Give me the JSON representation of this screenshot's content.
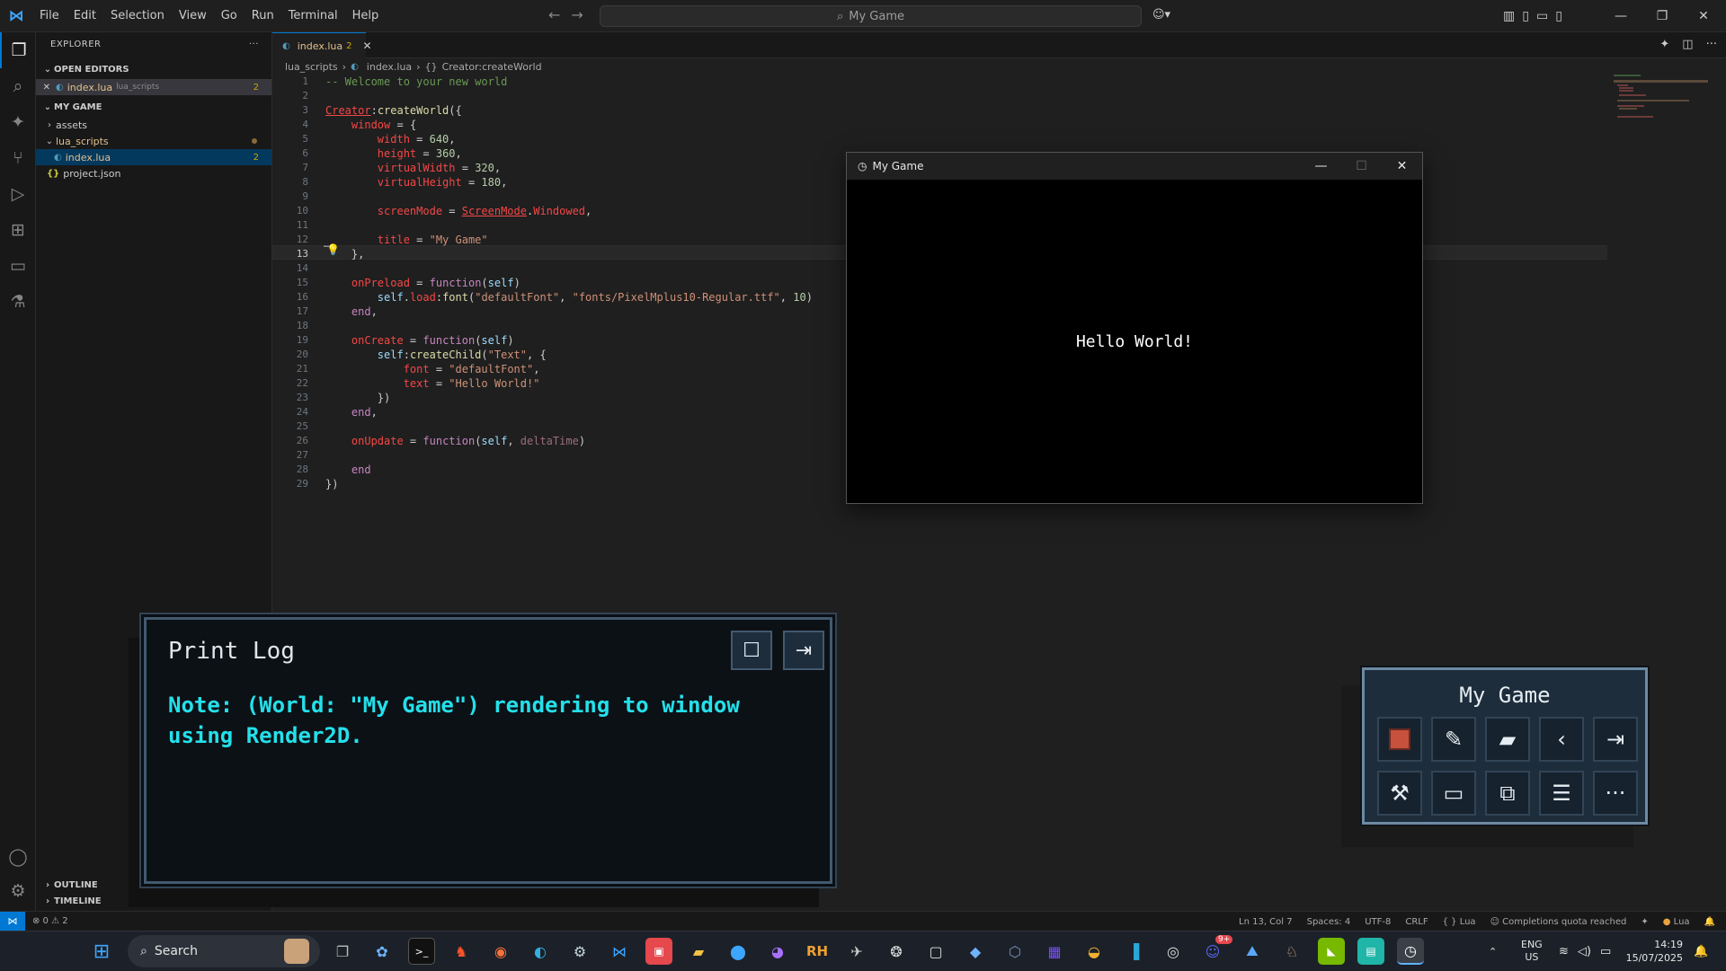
{
  "menu": [
    "File",
    "Edit",
    "Selection",
    "View",
    "Go",
    "Run",
    "Terminal",
    "Help"
  ],
  "command_center": "My Game",
  "explorer": {
    "title": "EXPLORER",
    "open_editors_label": "OPEN EDITORS",
    "open_file": "index.lua",
    "open_file_dir": "lua_scripts",
    "open_file_badge": "2",
    "project_label": "MY GAME",
    "tree": [
      {
        "name": "assets",
        "kind": "folder"
      },
      {
        "name": "lua_scripts",
        "kind": "folder"
      },
      {
        "name": "index.lua",
        "kind": "lua",
        "badge": "2"
      },
      {
        "name": "project.json",
        "kind": "json"
      }
    ],
    "outline_label": "OUTLINE",
    "timeline_label": "TIMELINE"
  },
  "tab": {
    "name": "index.lua",
    "badge": "2"
  },
  "breadcrumb": {
    "dir": "lua_scripts",
    "file": "index.lua",
    "symbol": "Creator:createWorld"
  },
  "code": {
    "line_numbers": [
      "1",
      "2",
      "3",
      "4",
      "5",
      "6",
      "7",
      "8",
      "9",
      "10",
      "11",
      "12",
      "13",
      "14",
      "15",
      "16",
      "17",
      "18",
      "19",
      "20",
      "21",
      "22",
      "23",
      "24",
      "25",
      "26",
      "27",
      "28",
      "29"
    ],
    "current_line": "13"
  },
  "game_window": {
    "title": "My Game",
    "minimize": "—",
    "maximize": "☐",
    "close": "✕",
    "content_text": "Hello World!"
  },
  "print_log": {
    "title": "Print Log",
    "message": "Note: (World: \"My Game\") rendering to window using Render2D."
  },
  "tool_panel": {
    "title": "My Game"
  },
  "statusbar": {
    "problems": "⊗ 0 ⚠ 2",
    "position": "Ln 13, Col 7",
    "spaces": "Spaces: 4",
    "encoding": "UTF-8",
    "eol": "CRLF",
    "language": "{ } Lua",
    "quota": "Completions quota reached",
    "lang_badge": "Lua"
  },
  "taskbar": {
    "search_label": "Search",
    "lang_line1": "ENG",
    "lang_line2": "US",
    "time": "14:19",
    "date": "15/07/2025",
    "rh_label": "RH",
    "discord_badge": "9+"
  },
  "colors": {
    "accent": "#0078d4",
    "log_text": "#24e0ea",
    "panel_border": "#43596e"
  }
}
